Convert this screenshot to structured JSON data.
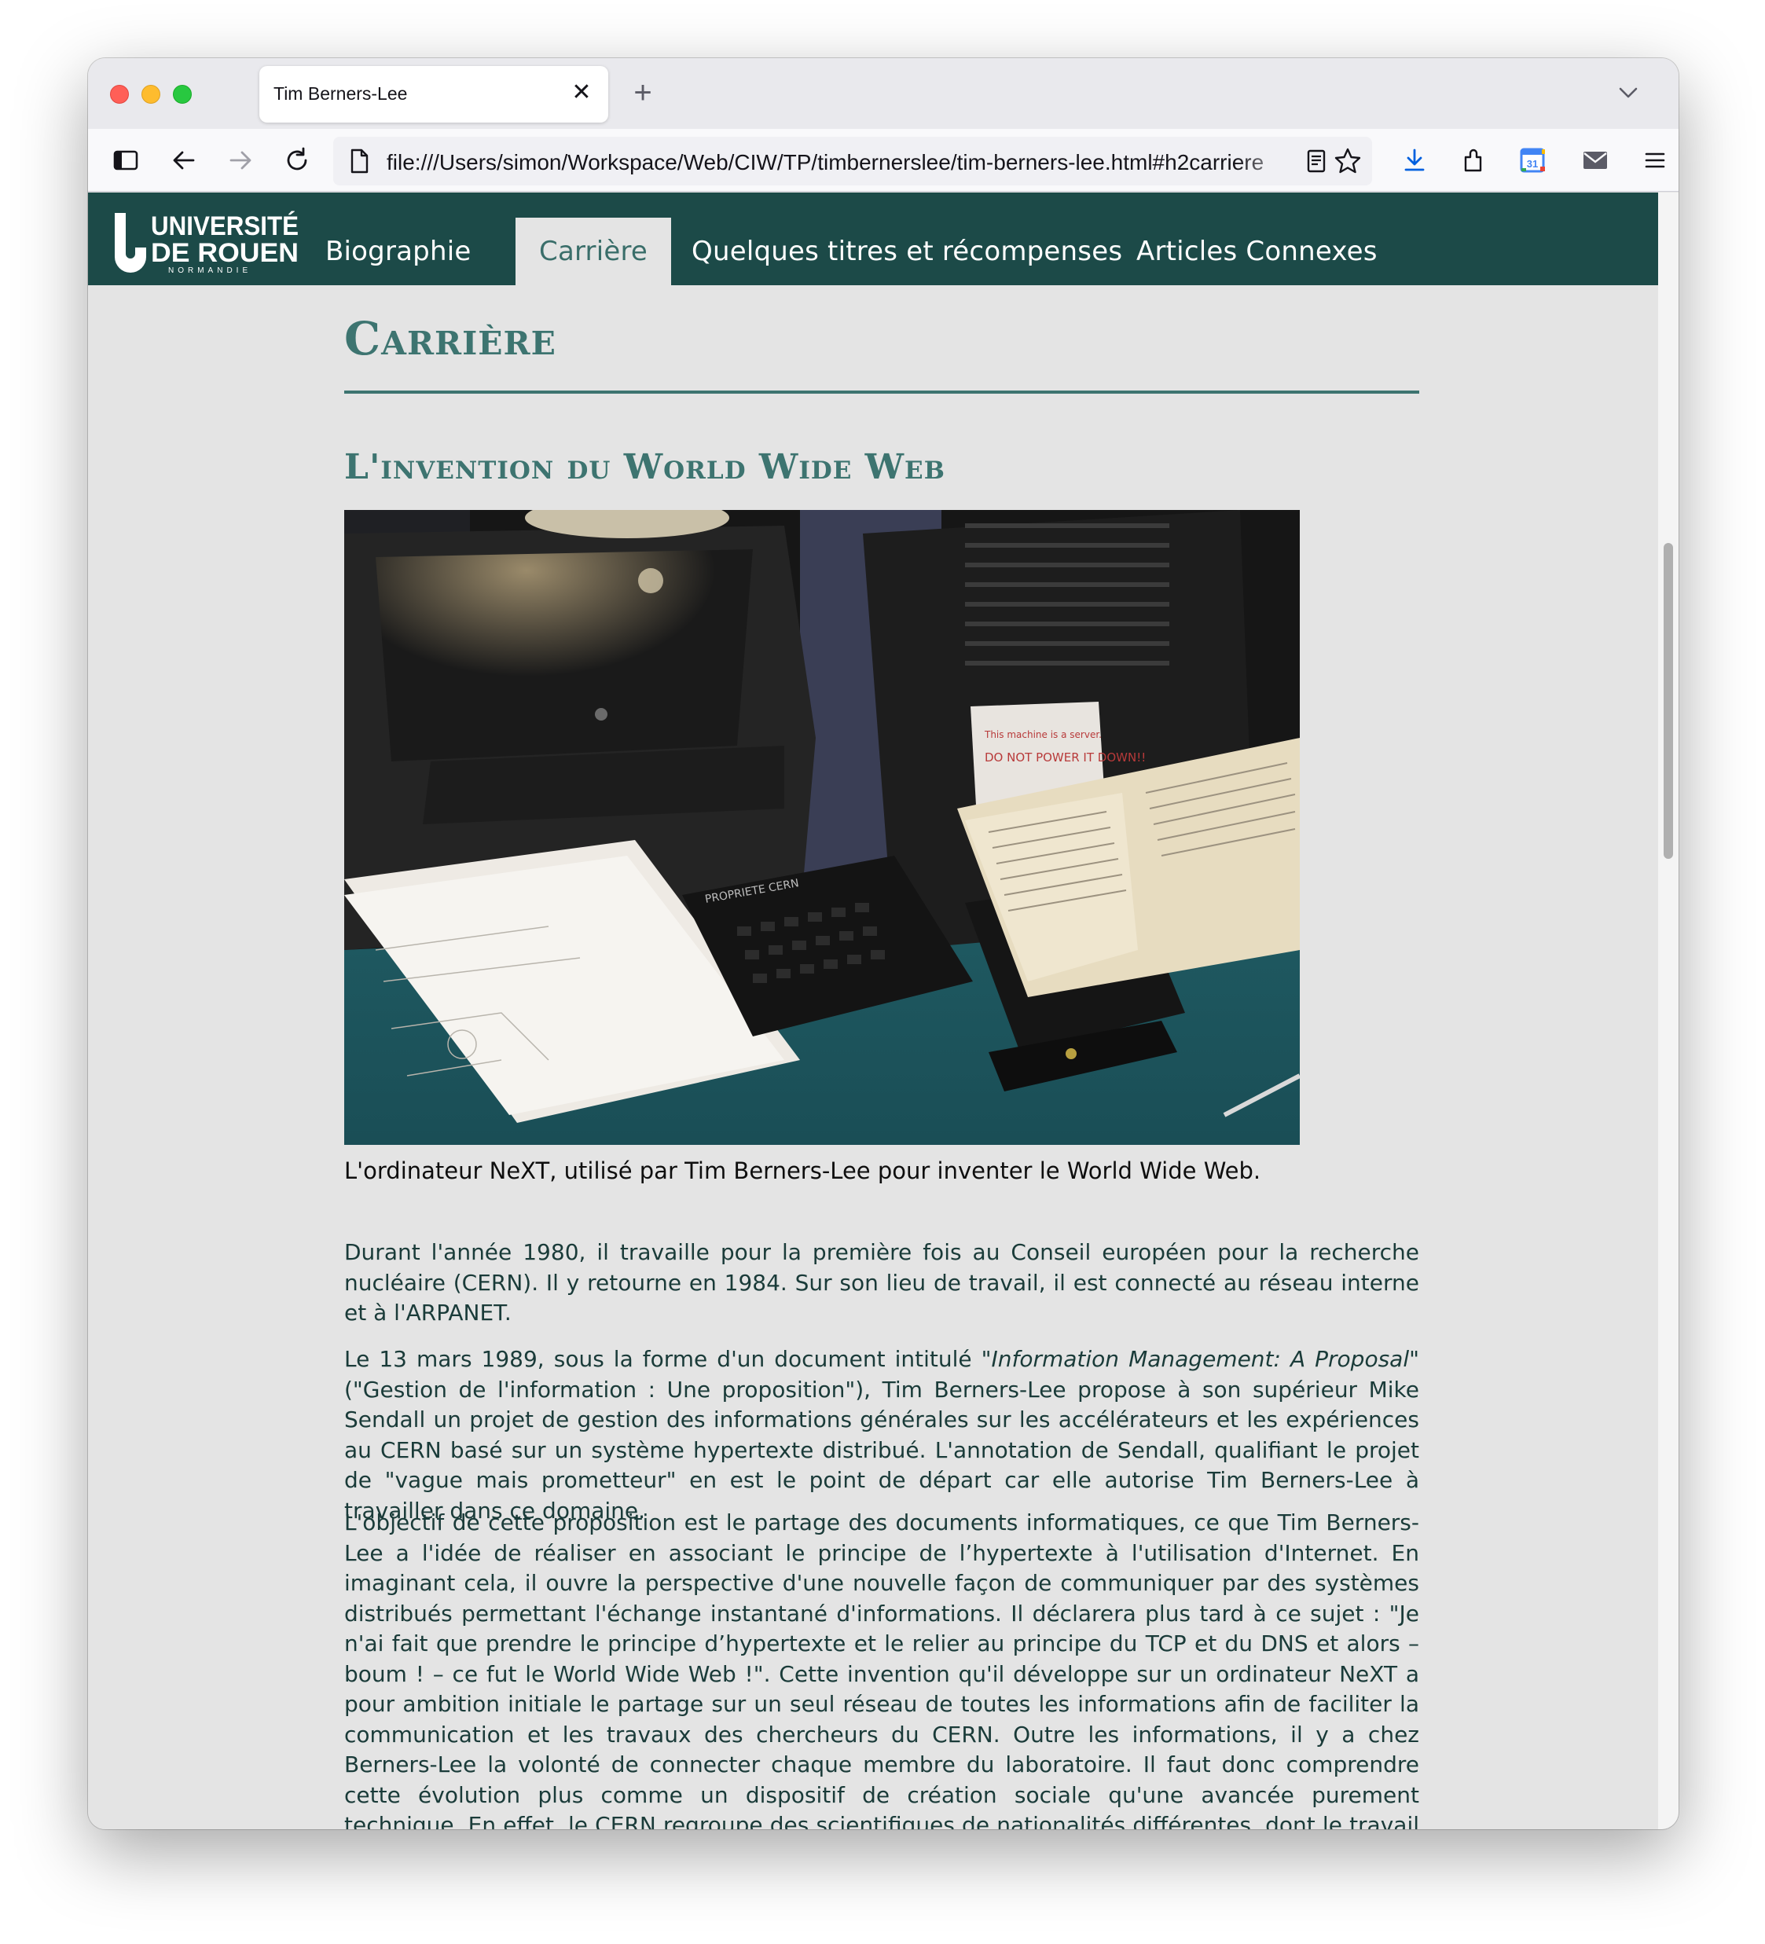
{
  "browser": {
    "tab_title": "Tim Berners-Lee",
    "tab_close": "✕",
    "new_tab": "+",
    "url": "file:///Users/simon/Workspace/Web/CIW/TP/timbernerslee/tim-berners-lee.html#h2carriere",
    "icons": [
      "sidebar-icon",
      "back-icon",
      "forward-icon",
      "reload-icon",
      "page-icon",
      "reader-view-icon",
      "bookmark-star-icon",
      "download-icon",
      "extensions-icon",
      "calendar-icon",
      "mail-icon",
      "menu-icon"
    ]
  },
  "site": {
    "logo_line1": "UNIVERSITÉ",
    "logo_line2": "DE ROUEN",
    "logo_line3": "NORMANDIE",
    "nav": [
      {
        "label": "Biographie"
      },
      {
        "label": "Carrière"
      },
      {
        "label": "Quelques titres et récompenses"
      },
      {
        "label": "Articles Connexes"
      }
    ],
    "colors": {
      "nav_bg": "#1c4a48",
      "heading": "#3d7470",
      "text": "#1a3b39"
    }
  },
  "content": {
    "h1": "Carrière",
    "h2": "L'invention du World Wide Web",
    "caption": "L'ordinateur NeXT, utilisé par Tim Berners-Lee pour inventer le World Wide Web.",
    "p1": "Durant l'année 1980, il travaille pour la première fois au Conseil européen pour la recherche nucléaire (CERN). Il y retourne en 1984. Sur son lieu de travail, il est connecté au réseau interne et à l'ARPANET.",
    "p2_before": "Le 13 mars 1989, sous la forme d'un document intitulé \"",
    "p2_em": "Information Management: A Proposal",
    "p2_after": "\" (\"Gestion de l'information : Une proposition\"), Tim Berners-Lee propose à son supérieur Mike Sendall un projet de gestion des informations générales sur les accélérateurs et les expériences au CERN basé sur un système hypertexte distribué. L'annotation de Sendall, qualifiant le projet de \"vague mais prometteur\" en est le point de départ car elle autorise Tim Berners-Lee à travailler dans ce domaine.",
    "p3": "L'objectif de cette proposition est le partage des documents informatiques, ce que Tim Berners-Lee a l'idée de réaliser en associant le principe de l’hypertexte à l'utilisation d'Internet. En imaginant cela, il ouvre la perspective d'une nouvelle façon de communiquer par des systèmes distribués permettant l'échange instantané d'informations. Il déclarera plus tard à ce sujet : \"Je n'ai fait que prendre le principe d’hypertexte et le relier au principe du TCP et du DNS et alors – boum ! – ce fut le World Wide Web !\". Cette invention qu'il développe sur un ordinateur NeXT a pour ambition initiale le partage sur un seul réseau de toutes les informations afin de faciliter la communication et les travaux des chercheurs du CERN. Outre les informations, il y a chez Berners-Lee la volonté de connecter chaque membre du laboratoire. Il faut donc comprendre cette évolution plus comme un dispositif de création sociale qu'une avancée purement technique. En effet, le CERN regroupe des scientifiques de nationalités différentes, dont le travail se fait en partie en dehors du laboratoire genevois, c'est-à-dire dans leur pays d'origine."
  },
  "photo": {
    "sticker_line1": "This machine is a server.",
    "sticker_line2": "DO NOT POWER IT DOWN!!",
    "keyboard_label": "PROPRIETE CERN"
  }
}
